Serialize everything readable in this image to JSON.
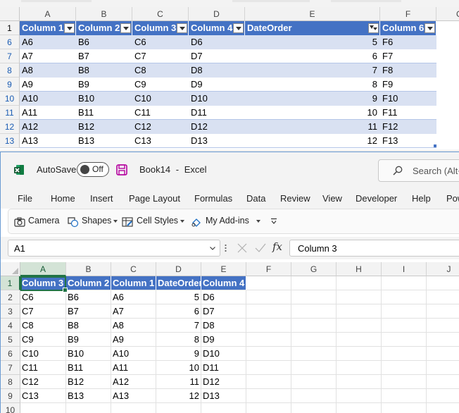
{
  "background_sheet": {
    "column_letters": [
      "A",
      "B",
      "C",
      "D",
      "E",
      "F",
      "G"
    ],
    "header_row_number": "1",
    "table_headers": [
      "Column 1",
      "Column 2",
      "Column 3",
      "Column 4",
      "DateOrder",
      "Column 6"
    ],
    "filtered_column": "DateOrder",
    "rows": [
      {
        "row": "6",
        "cells": [
          "A6",
          "B6",
          "C6",
          "D6",
          "5",
          "F6"
        ]
      },
      {
        "row": "7",
        "cells": [
          "A7",
          "B7",
          "C7",
          "D7",
          "6",
          "F7"
        ]
      },
      {
        "row": "8",
        "cells": [
          "A8",
          "B8",
          "C8",
          "D8",
          "7",
          "F8"
        ]
      },
      {
        "row": "9",
        "cells": [
          "A9",
          "B9",
          "C9",
          "D9",
          "8",
          "F9"
        ]
      },
      {
        "row": "10",
        "cells": [
          "A10",
          "B10",
          "C10",
          "D10",
          "9",
          "F10"
        ]
      },
      {
        "row": "11",
        "cells": [
          "A11",
          "B11",
          "C11",
          "D11",
          "10",
          "F11"
        ]
      },
      {
        "row": "12",
        "cells": [
          "A12",
          "B12",
          "C12",
          "D12",
          "11",
          "F12"
        ]
      },
      {
        "row": "13",
        "cells": [
          "A13",
          "B13",
          "C13",
          "D13",
          "12",
          "F13"
        ]
      }
    ]
  },
  "window": {
    "autosave_label": "AutoSave",
    "autosave_state": "Off",
    "file_name": "Book14",
    "separator": "-",
    "app_name": "Excel",
    "search_placeholder": "Search (Alt+Q)"
  },
  "menu": [
    "File",
    "Home",
    "Insert",
    "Page Layout",
    "Formulas",
    "Data",
    "Review",
    "View",
    "Developer",
    "Help",
    "Power Pivot"
  ],
  "toolbar": {
    "camera": "Camera",
    "shapes": "Shapes",
    "cell_styles": "Cell Styles",
    "my_addins": "My Add-ins"
  },
  "formula_bar": {
    "name_box": "A1",
    "fx": "fx",
    "formula": "Column 3"
  },
  "sheet": {
    "column_letters": [
      "A",
      "B",
      "C",
      "D",
      "E",
      "F",
      "G",
      "H",
      "I",
      "J"
    ],
    "active_column": "A",
    "active_row": "1",
    "header_row": [
      "Column 3",
      "Column 2",
      "Column 1",
      "DateOrder",
      "Column 4"
    ],
    "rows": [
      {
        "row": "1",
        "cells": [
          "Column 3",
          "Column 2",
          "Column 1",
          "DateOrder",
          "Column 4"
        ]
      },
      {
        "row": "2",
        "cells": [
          "C6",
          "B6",
          "A6",
          "5",
          "D6"
        ]
      },
      {
        "row": "3",
        "cells": [
          "C7",
          "B7",
          "A7",
          "6",
          "D7"
        ]
      },
      {
        "row": "4",
        "cells": [
          "C8",
          "B8",
          "A8",
          "7",
          "D8"
        ]
      },
      {
        "row": "5",
        "cells": [
          "C9",
          "B9",
          "A9",
          "8",
          "D9"
        ]
      },
      {
        "row": "6",
        "cells": [
          "C10",
          "B10",
          "A10",
          "9",
          "D10"
        ]
      },
      {
        "row": "7",
        "cells": [
          "C11",
          "B11",
          "A11",
          "10",
          "D11"
        ]
      },
      {
        "row": "8",
        "cells": [
          "C12",
          "B12",
          "A12",
          "11",
          "D12"
        ]
      },
      {
        "row": "9",
        "cells": [
          "C13",
          "B13",
          "A13",
          "12",
          "D13"
        ]
      },
      {
        "row": "10",
        "cells": [
          "",
          "",
          "",
          "",
          ""
        ]
      }
    ]
  },
  "colors": {
    "table_header": "#4472c4",
    "table_band": "#d9e1f2",
    "excel_green": "#217346",
    "save_icon": "#b4009e"
  }
}
